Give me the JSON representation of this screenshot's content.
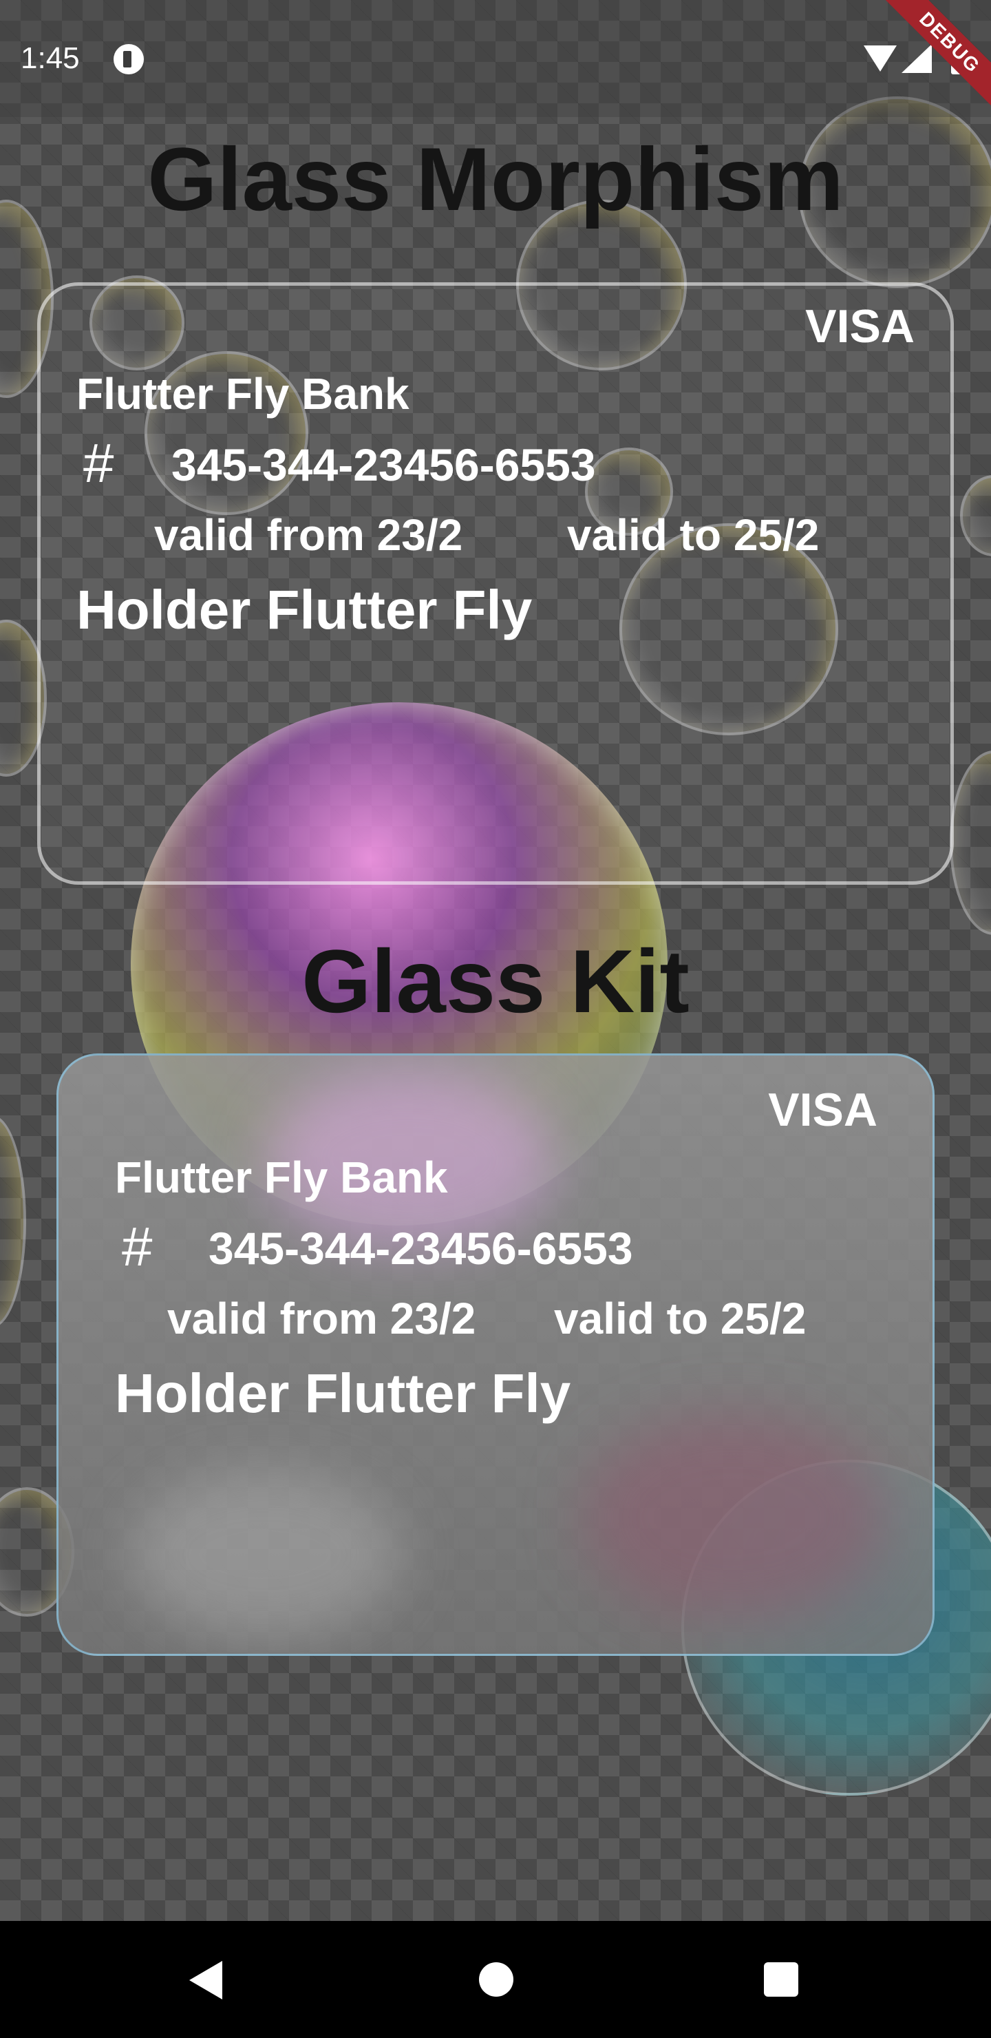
{
  "status_bar": {
    "time": "1:45"
  },
  "debug_banner": "DEBUG",
  "section1": {
    "title": "Glass Morphism",
    "card": {
      "brand": "VISA",
      "bank": "Flutter Fly Bank",
      "hash": "#",
      "number": "345-344-23456-6553",
      "valid_from": "valid from 23/2",
      "valid_to": "valid to 25/2",
      "holder": "Holder Flutter Fly"
    }
  },
  "section2": {
    "title": "Glass Kit",
    "card": {
      "brand": "VISA",
      "bank": "Flutter Fly Bank",
      "hash": "#",
      "number": "345-344-23456-6553",
      "valid_from": "valid from 23/2",
      "valid_to": "valid to 25/2",
      "holder": "Holder Flutter Fly"
    }
  },
  "colors": {
    "title_text": "#151515",
    "card_text": "#ffffff",
    "debug_banner": "#a3242b",
    "kit_border": "#8cc8e6"
  }
}
